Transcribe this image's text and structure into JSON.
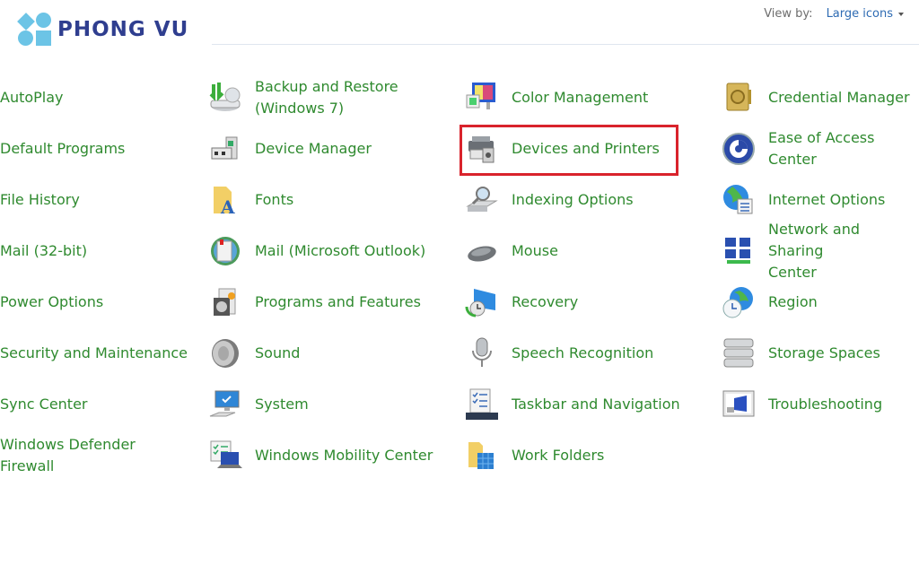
{
  "brand": {
    "name": "PHONG VU"
  },
  "header": {
    "view_by_label": "View by:",
    "view_by_value": "Large icons"
  },
  "highlighted_item": "Devices and Printers",
  "items": [
    {
      "label": "AutoPlay",
      "icon": "autoplay-icon"
    },
    {
      "label": "Default Programs",
      "icon": "default-programs-icon"
    },
    {
      "label": "File History",
      "icon": "file-history-icon"
    },
    {
      "label": "Mail (32-bit)",
      "icon": "mail-icon"
    },
    {
      "label": "Power Options",
      "icon": "power-options-icon"
    },
    {
      "label": "Security and Maintenance",
      "icon": "security-maintenance-icon"
    },
    {
      "label": "Sync Center",
      "icon": "sync-center-icon"
    },
    {
      "label": "Windows Defender\nFirewall",
      "icon": "firewall-icon"
    },
    {
      "label": "Backup and Restore\n(Windows 7)",
      "icon": "backup-restore-icon"
    },
    {
      "label": "Device Manager",
      "icon": "device-manager-icon"
    },
    {
      "label": "Fonts",
      "icon": "fonts-icon"
    },
    {
      "label": "Mail (Microsoft Outlook)",
      "icon": "outlook-mail-icon"
    },
    {
      "label": "Programs and Features",
      "icon": "programs-features-icon"
    },
    {
      "label": "Sound",
      "icon": "speaker-icon"
    },
    {
      "label": "System",
      "icon": "computer-icon"
    },
    {
      "label": "Windows Mobility Center",
      "icon": "mobility-center-icon"
    },
    {
      "label": "Color Management",
      "icon": "color-management-icon"
    },
    {
      "label": "Devices and Printers",
      "icon": "printer-icon"
    },
    {
      "label": "Indexing Options",
      "icon": "indexing-icon"
    },
    {
      "label": "Mouse",
      "icon": "mouse-icon"
    },
    {
      "label": "Recovery",
      "icon": "recovery-icon"
    },
    {
      "label": "Speech Recognition",
      "icon": "microphone-icon"
    },
    {
      "label": "Taskbar and Navigation",
      "icon": "taskbar-icon"
    },
    {
      "label": "Work Folders",
      "icon": "work-folders-icon"
    },
    {
      "label": "Credential Manager",
      "icon": "credential-vault-icon"
    },
    {
      "label": "Ease of Access Center",
      "icon": "ease-of-access-icon"
    },
    {
      "label": "Internet Options",
      "icon": "internet-options-icon"
    },
    {
      "label": "Network and Sharing\nCenter",
      "icon": "network-icon"
    },
    {
      "label": "Region",
      "icon": "region-globe-clock-icon"
    },
    {
      "label": "Storage Spaces",
      "icon": "storage-spaces-icon"
    },
    {
      "label": "Troubleshooting",
      "icon": "troubleshooting-icon"
    }
  ]
}
